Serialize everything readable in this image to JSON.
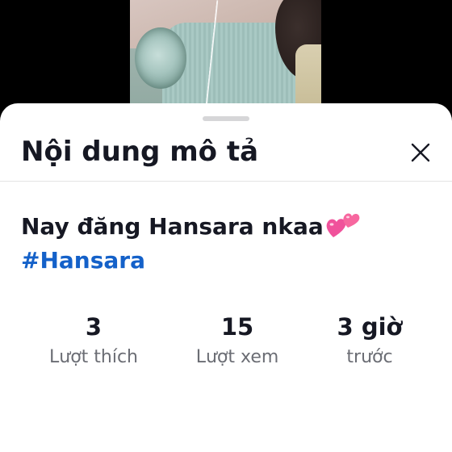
{
  "sheet": {
    "title": "Nội dung mô tả",
    "close_icon": "close-icon"
  },
  "description": {
    "text": "Nay đăng Hansara nkaa",
    "emoji": "two-hearts-emoji",
    "hashtag": "#Hansara"
  },
  "stats": {
    "likes": {
      "value": "3",
      "label": "Lượt thích"
    },
    "views": {
      "value": "15",
      "label": "Lượt xem"
    },
    "time": {
      "value": "3 giờ",
      "label": "trước"
    }
  },
  "colors": {
    "hashtag": "#1461c9",
    "title_text": "#161823",
    "secondary_text": "#6b6d74",
    "emoji_pink": "#f0529b"
  }
}
